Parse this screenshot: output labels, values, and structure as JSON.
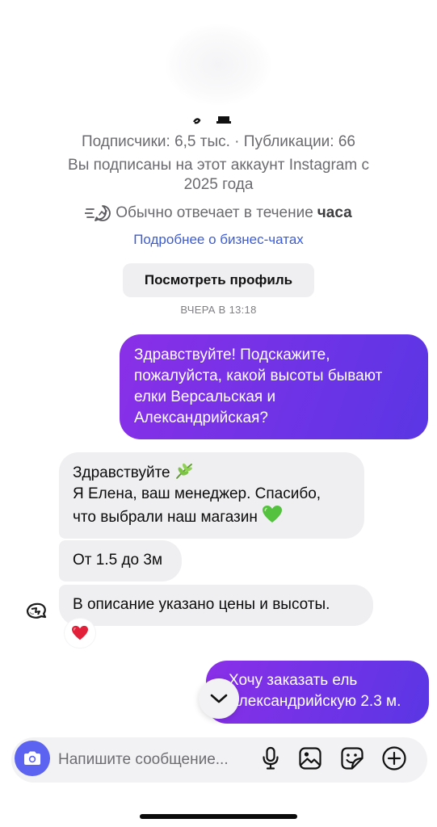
{
  "profile": {
    "stats": "Подписчики: 6,5 тыс. · Публикации: 66",
    "subscribed_line1": "Вы подписаны на этот аккаунт Instagram с",
    "subscribed_line2": "2025 года",
    "response_prefix": "Обычно отвечает в течение",
    "response_value": "часа",
    "business_chats_link": "Подробнее о бизнес-чатах",
    "view_profile_button": "Посмотреть профиль"
  },
  "thread": {
    "timestamp": "ВЧЕРА В 13:18",
    "messages": [
      {
        "direction": "outgoing",
        "lines": [
          "Здравствуйте! Подскажите,",
          "пожалуйста, какой высоты бывают",
          "елки Версальская и",
          "Александрийская?"
        ]
      },
      {
        "direction": "incoming",
        "lines": [
          "Здравствуйте",
          "Я Елена, ваш менеджер. Спасибо,",
          "что выбрали наш магазин"
        ],
        "emojis": [
          "herb",
          "green-heart"
        ]
      },
      {
        "direction": "incoming",
        "lines": [
          "От 1.5 до 3м"
        ]
      },
      {
        "direction": "incoming",
        "lines": [
          "В описание указано цены и высоты."
        ],
        "reaction": "red-heart"
      },
      {
        "direction": "outgoing",
        "lines": [
          "Хочу заказать ель",
          "Александрийскую 2.3 м."
        ]
      }
    ]
  },
  "composer": {
    "placeholder": "Напишите сообщение..."
  },
  "icons": {
    "camera": "camera-icon",
    "microphone": "microphone-icon",
    "gallery": "gallery-icon",
    "sticker": "sticker-icon",
    "add": "plus-circle-icon",
    "scroll_down": "chevron-down-icon",
    "response_time": "fast-reply-icon"
  },
  "colors": {
    "outgoing_bubble_start": "#8a2fe8",
    "outgoing_bubble_end": "#5a36e4",
    "incoming_bubble": "#efeff2",
    "link": "#3c5cd6",
    "camera_button": "#5b63f0"
  }
}
